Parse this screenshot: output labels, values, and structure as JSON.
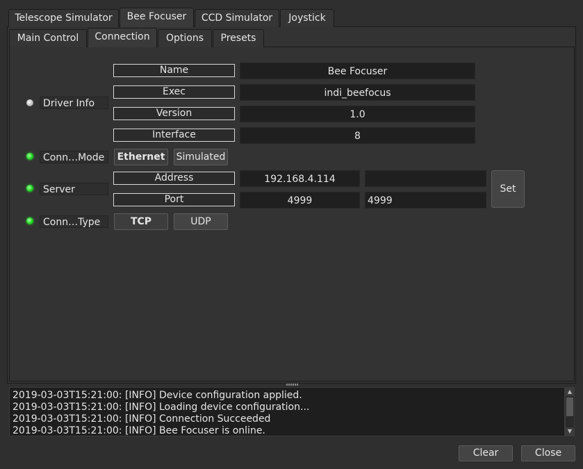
{
  "tabs": [
    {
      "label": "Telescope Simulator",
      "active": false
    },
    {
      "label": "Bee Focuser",
      "active": true
    },
    {
      "label": "CCD Simulator",
      "active": false
    },
    {
      "label": "Joystick",
      "active": false
    }
  ],
  "subtabs": [
    {
      "label": "Main Control",
      "active": false
    },
    {
      "label": "Connection",
      "active": true
    },
    {
      "label": "Options",
      "active": false
    },
    {
      "label": "Presets",
      "active": false
    }
  ],
  "driver_info": {
    "label": "Driver Info",
    "state": "idle",
    "rows": [
      {
        "name": "Name",
        "value": "Bee Focuser"
      },
      {
        "name": "Exec",
        "value": "indi_beefocus"
      },
      {
        "name": "Version",
        "value": "1.0"
      },
      {
        "name": "Interface",
        "value": "8"
      }
    ]
  },
  "connection_mode": {
    "label": "Conn…Mode",
    "state": "ok",
    "options": [
      "Ethernet",
      "Simulated"
    ],
    "selected": "Ethernet"
  },
  "server": {
    "label": "Server",
    "state": "ok",
    "address_label": "Address",
    "address_value": "192.168.4.114",
    "address_input": "",
    "port_label": "Port",
    "port_value": "4999",
    "port_input": "4999",
    "set_label": "Set"
  },
  "connection_type": {
    "label": "Conn…Type",
    "state": "ok",
    "options": [
      "TCP",
      "UDP"
    ],
    "selected": "TCP"
  },
  "log": [
    "2019-03-03T15:21:00: [INFO] Device configuration applied.",
    "2019-03-03T15:21:00: [INFO] Loading device configuration...",
    "2019-03-03T15:21:00: [INFO] Connection Succeeded",
    "2019-03-03T15:21:00: [INFO] Bee Focuser is online."
  ],
  "footer": {
    "clear_label": "Clear",
    "close_label": "Close"
  },
  "colors": {
    "led_ok": "#22d422",
    "led_idle": "#c8c8c8",
    "background": "#2f2f2f"
  }
}
